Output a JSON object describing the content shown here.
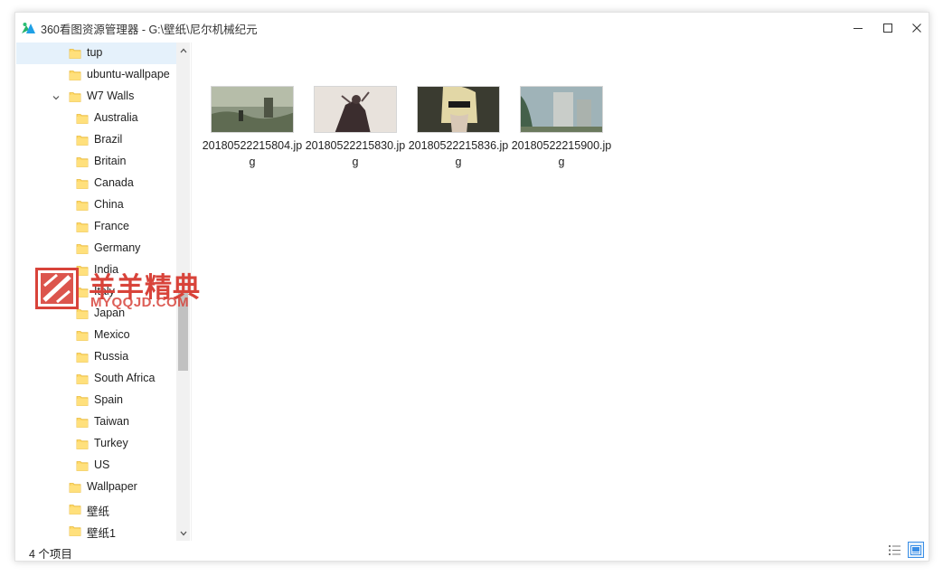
{
  "window": {
    "title": "360看图资源管理器 - G:\\壁纸\\尼尔机械纪元",
    "icons": {
      "app": "app-logo-icon",
      "minimize": "minimize-icon",
      "maximize": "maximize-icon",
      "close": "close-icon"
    }
  },
  "tree": {
    "items": [
      {
        "label": "tup",
        "level": 1,
        "selected": true
      },
      {
        "label": "ubuntu-wallpape",
        "level": 1
      },
      {
        "label": "W7 Walls",
        "level": 1,
        "expanded": true
      },
      {
        "label": "Australia",
        "level": 2
      },
      {
        "label": "Brazil",
        "level": 2
      },
      {
        "label": "Britain",
        "level": 2
      },
      {
        "label": "Canada",
        "level": 2
      },
      {
        "label": "China",
        "level": 2
      },
      {
        "label": "France",
        "level": 2
      },
      {
        "label": "Germany",
        "level": 2
      },
      {
        "label": "India",
        "level": 2
      },
      {
        "label": "Italy",
        "level": 2
      },
      {
        "label": "Japan",
        "level": 2
      },
      {
        "label": "Mexico",
        "level": 2
      },
      {
        "label": "Russia",
        "level": 2
      },
      {
        "label": "South Africa",
        "level": 2
      },
      {
        "label": "Spain",
        "level": 2
      },
      {
        "label": "Taiwan",
        "level": 2
      },
      {
        "label": "Turkey",
        "level": 2
      },
      {
        "label": "US",
        "level": 2
      },
      {
        "label": "Wallpaper",
        "level": 1
      },
      {
        "label": "壁纸",
        "level": 1
      },
      {
        "label": "壁纸1",
        "level": 1
      }
    ]
  },
  "files": [
    {
      "name": "20180522215804.jpg",
      "thumb": "ruins-landscape"
    },
    {
      "name": "20180522215830.jpg",
      "thumb": "dark-figure-white-bg"
    },
    {
      "name": "20180522215836.jpg",
      "thumb": "blonde-android-portrait"
    },
    {
      "name": "20180522215900.jpg",
      "thumb": "overgrown-city-buildings"
    }
  ],
  "status": {
    "count_text": "4 个项目"
  },
  "watermark": {
    "text_cn": "羊羊精典",
    "text_en": "MYQQJD.COM"
  },
  "colors": {
    "selection": "#e5f1fb",
    "folder": "#ffd968",
    "accent": "#3a8ee6",
    "watermark": "#d8433a"
  }
}
